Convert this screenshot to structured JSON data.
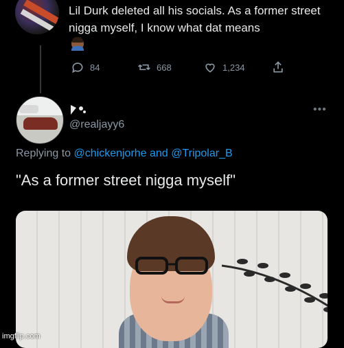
{
  "top_tweet": {
    "text": "Lil Durk deleted all his socials. As a former street nigga myself, I know what dat means",
    "avatar_icon": "spider-graphic-avatar",
    "emoji_icon": "man-emoji-icon",
    "actions": {
      "reply_count": "84",
      "retweet_count": "668",
      "like_count": "1,234"
    }
  },
  "reply_tweet": {
    "avatar_icon": "car-avatar",
    "name_icon": "name-glyph-icon",
    "handle": "@realjayy6",
    "replying_prefix": "Replying to",
    "replying_user1": "@chickenjorhe",
    "replying_and": "and",
    "replying_user2": "@Tripolar_B",
    "text": "\"As a former street nigga myself\"",
    "more_icon": "more-dots-icon"
  },
  "watermark": "imgflip.com",
  "colors": {
    "background": "#000000",
    "text": "#e7e9ea",
    "muted": "#8b98a5",
    "link": "#1d9bf0"
  }
}
